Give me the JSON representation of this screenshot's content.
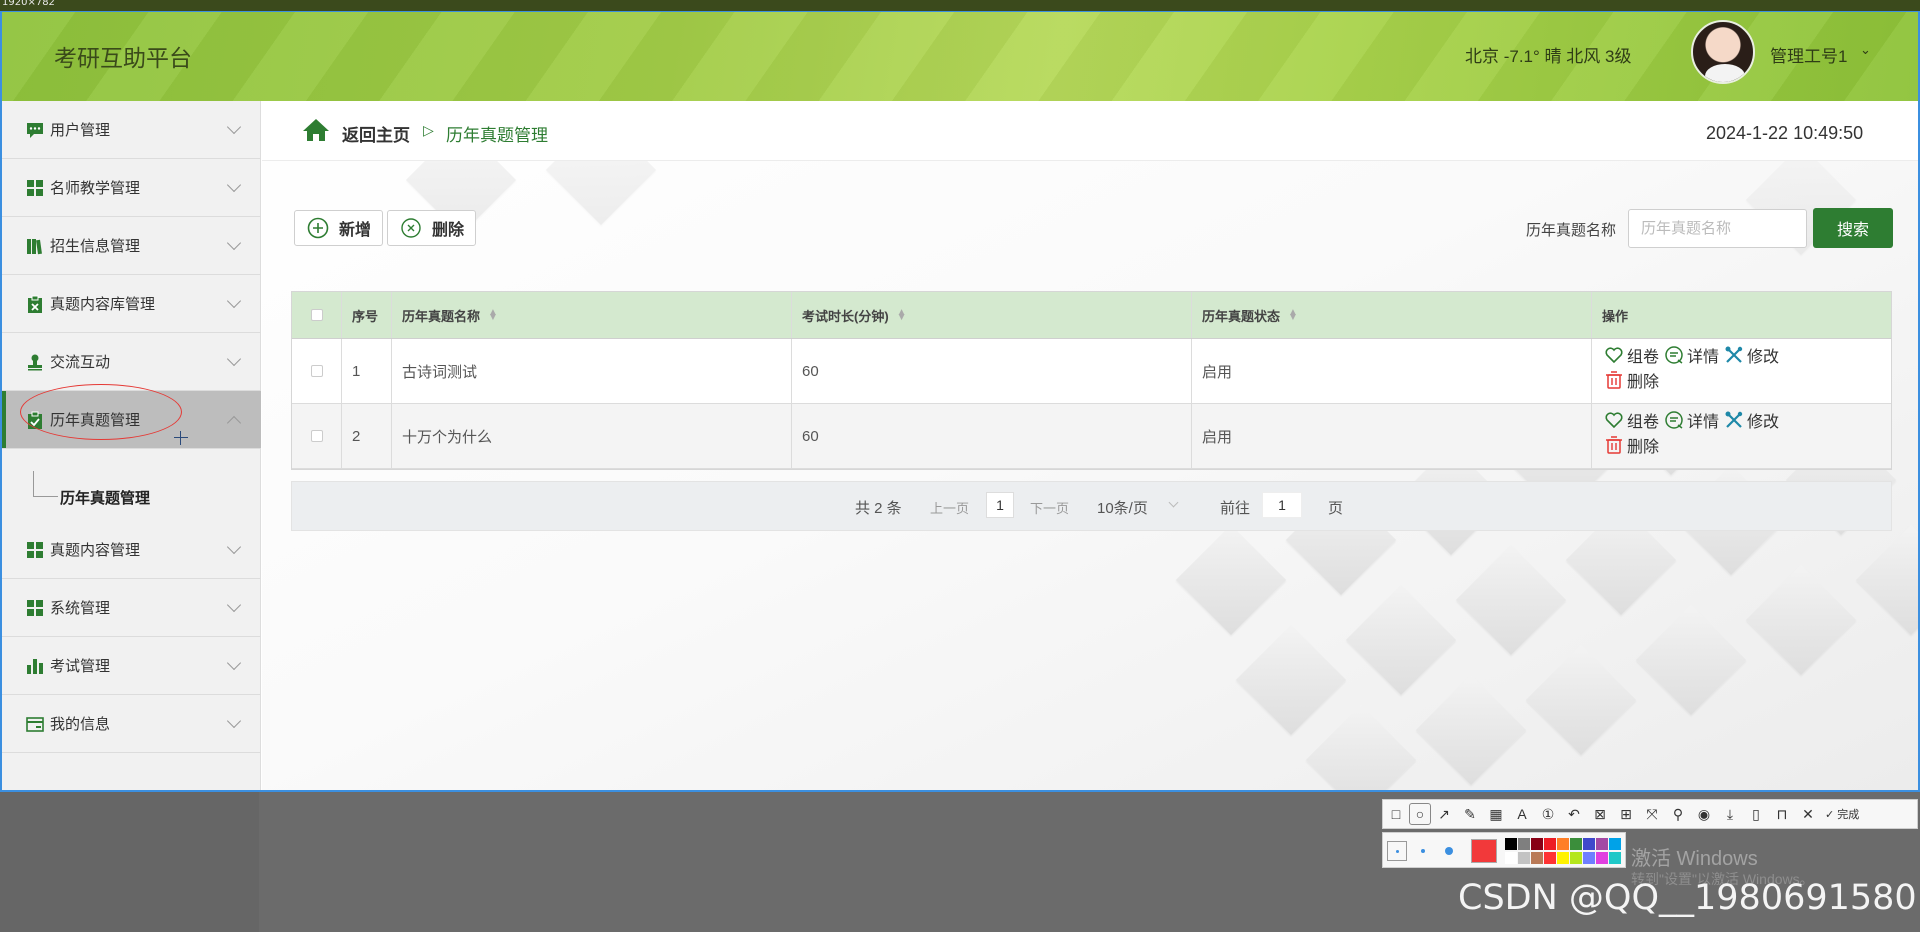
{
  "screen": {
    "size_label": "1920×782"
  },
  "header": {
    "app_title": "考研互助平台",
    "weather": "北京  -7.1°  晴  北风  3级",
    "user_name": "管理工号1",
    "user_chevron": "⌄"
  },
  "sidebar": {
    "items": [
      {
        "label": "用户管理",
        "icon": "chat-icon"
      },
      {
        "label": "名师教学管理",
        "icon": "grid-icon"
      },
      {
        "label": "招生信息管理",
        "icon": "books-icon"
      },
      {
        "label": "真题内容库管理",
        "icon": "clipboard-x-icon"
      },
      {
        "label": "交流互动",
        "icon": "stamp-icon"
      },
      {
        "label": "历年真题管理",
        "icon": "clipboard-check-icon",
        "expanded": true
      },
      {
        "label": "真题内容管理",
        "icon": "grid-icon"
      },
      {
        "label": "系统管理",
        "icon": "grid-icon"
      },
      {
        "label": "考试管理",
        "icon": "bar-chart-icon"
      },
      {
        "label": "我的信息",
        "icon": "card-icon"
      }
    ],
    "sub_item": "历年真题管理"
  },
  "breadcrumb": {
    "home": "返回主页",
    "separator": "▷",
    "current": "历年真题管理"
  },
  "datetime": "2024-1-22 10:49:50",
  "toolbar": {
    "add_label": "新增",
    "delete_label": "删除",
    "search_label": "历年真题名称",
    "search_placeholder": "历年真题名称",
    "search_button": "搜索"
  },
  "table": {
    "headers": [
      "序号",
      "历年真题名称",
      "考试时长(分钟)",
      "历年真题状态",
      "操作"
    ],
    "rows": [
      {
        "no": "1",
        "name": "古诗词测试",
        "duration": "60",
        "status": "启用"
      },
      {
        "no": "2",
        "name": "十万个为什么",
        "duration": "60",
        "status": "启用"
      }
    ],
    "actions": {
      "paper": "组卷",
      "detail": "详情",
      "edit": "修改",
      "delete": "删除"
    }
  },
  "pagination": {
    "total": "共 2 条",
    "prev": "上一页",
    "page": "1",
    "next": "下一页",
    "page_size": "10条/页",
    "goto": "前往",
    "goto_value": "1",
    "page_unit": "页"
  },
  "capture_tool": {
    "done_label": "完成",
    "current_color": "#f2393a",
    "palette": [
      "#000000",
      "#7f7f7f",
      "#880015",
      "#ed1c24",
      "#ff7f27",
      "#3b8e3b",
      "#3f48cc",
      "#a349a4",
      "#00a2e8",
      "#ffffff",
      "#c3c3c3",
      "#b97a57",
      "#ff3333",
      "#fff200",
      "#b5e61d",
      "#6f7fff",
      "#e040e0",
      "#1fc8c8"
    ]
  },
  "system": {
    "windows_activate": "激活 Windows",
    "windows_activate_hint": "转到\"设置\"以激活 Windows。",
    "watermark": "CSDN @QQ__1980691580"
  },
  "colors": {
    "brand_green": "#2e7d32",
    "header_green": "#a2cc47",
    "annotation_red": "#e53935"
  }
}
